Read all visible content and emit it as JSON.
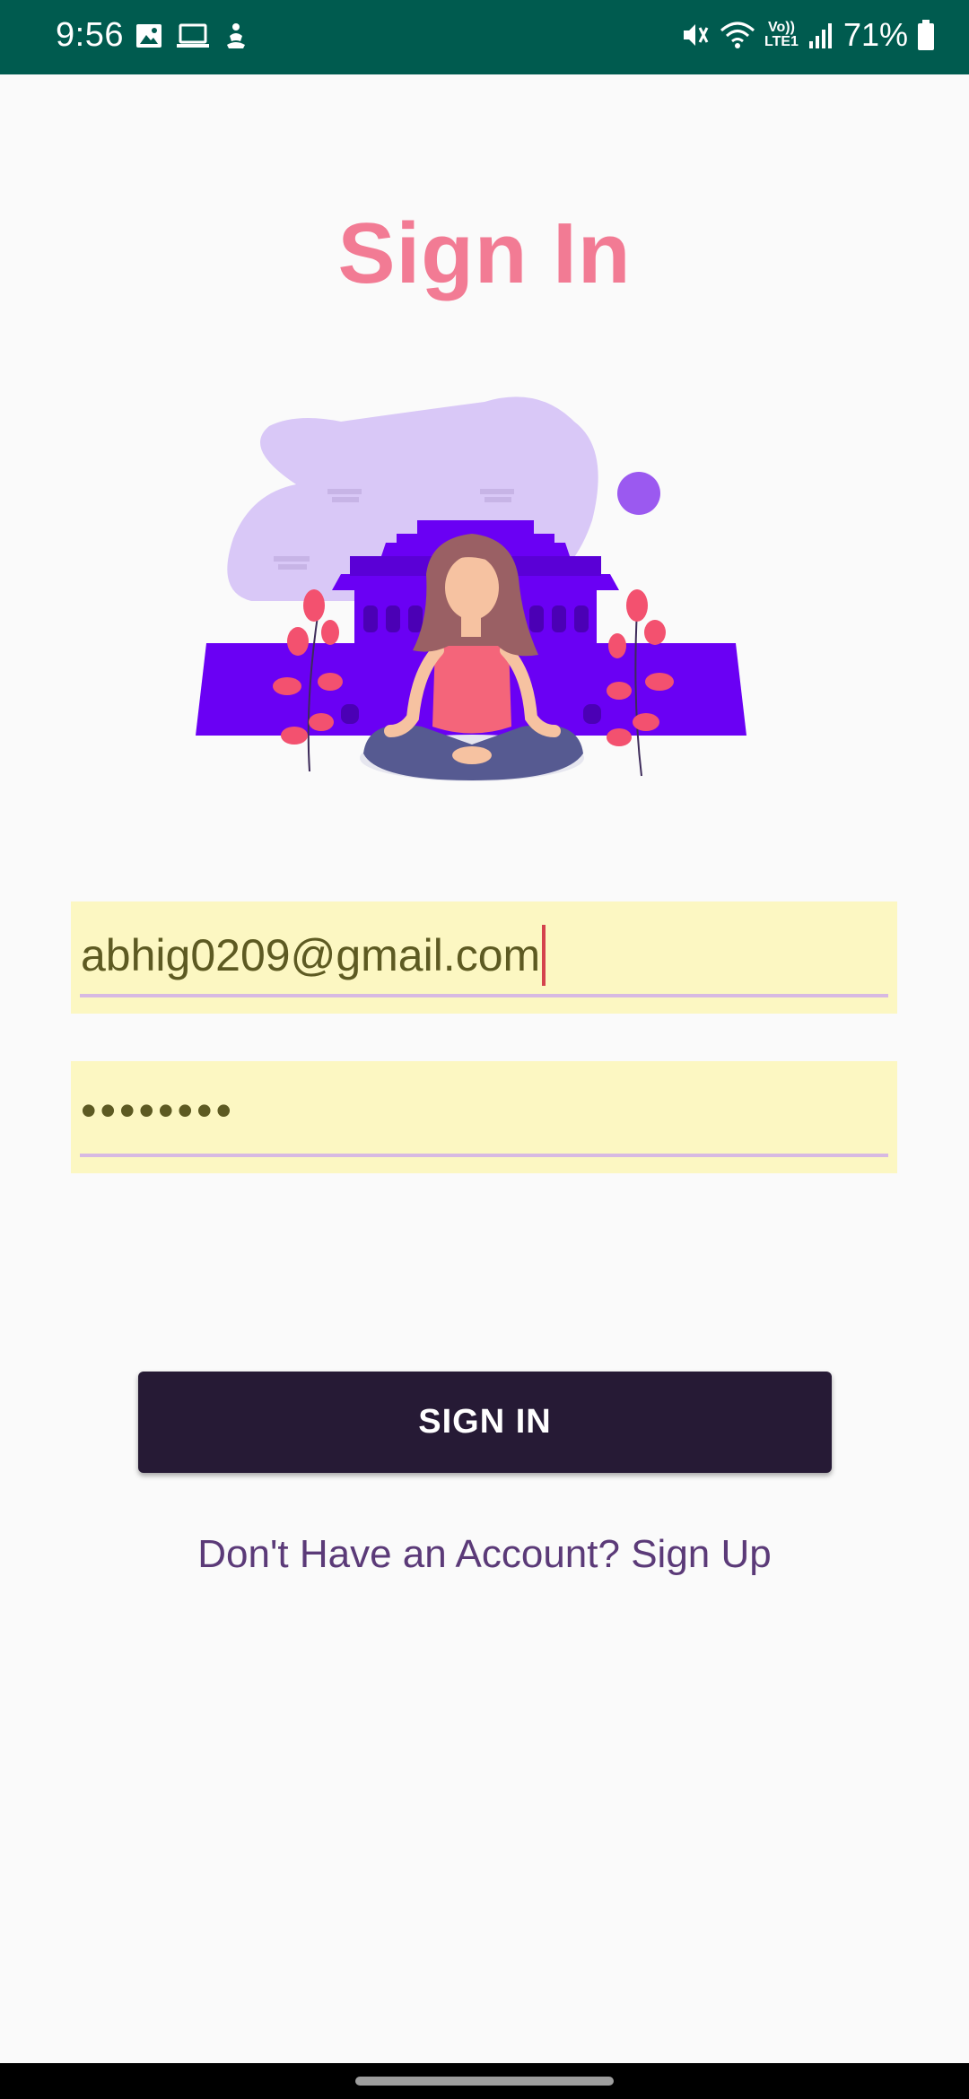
{
  "status_bar": {
    "time": "9:56",
    "battery": "71%",
    "volte_line1": "Vo))",
    "volte_line2": "LTE1",
    "left_icons": [
      "image-icon",
      "laptop-icon",
      "app-notification-icon"
    ],
    "right_icons": [
      "mute-icon",
      "wifi-icon",
      "volte-icon",
      "signal-icon",
      "battery-icon"
    ]
  },
  "page": {
    "title": "Sign In",
    "illustration": "meditation-illustration"
  },
  "form": {
    "email_value": "abhig0209@gmail.com",
    "password_value": "••••••••",
    "signin_label": "SIGN IN",
    "signup_link": "Don't Have an Account? Sign Up"
  },
  "colors": {
    "status_bar": "#005b4f",
    "title": "#f27b94",
    "input_bg": "#fcf7c2",
    "button_bg": "#261a35",
    "link": "#5b3a78",
    "illustration_purple": "#6a00f4",
    "illustration_blob": "#d9c8f7"
  }
}
